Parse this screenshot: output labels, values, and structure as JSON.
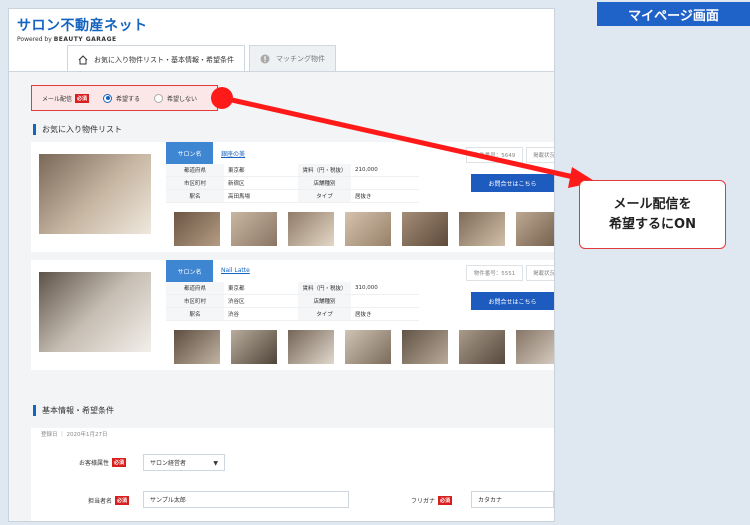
{
  "page_title": "マイページ画面",
  "logo": {
    "main": "サロン不動産ネット",
    "powered": "Powered by",
    "brand": "BEAUTY GARAGE"
  },
  "tabs": [
    {
      "label": "お気に入り物件リスト・基本情報・希望条件",
      "active": true,
      "icon": "home-icon"
    },
    {
      "label": "マッチング物件",
      "active": false,
      "icon": "alert-circle-icon"
    }
  ],
  "mail": {
    "label": "メール配信",
    "required": "必須",
    "options": [
      "希望する",
      "希望しない"
    ],
    "selected": 0
  },
  "favorites_title": "お気に入り物件リスト",
  "listings": [
    {
      "salon_label": "サロン名",
      "name": "銀座の美",
      "bukken_no": "物件番号：5649",
      "status": "掲載状況",
      "fields": [
        {
          "k": "都道府県",
          "v": "東京都",
          "k2": "賃料（円・税抜）",
          "v2": "210,000"
        },
        {
          "k": "市区町村",
          "v": "新宿区",
          "k2": "店舗種別",
          "v2": ""
        },
        {
          "k": "駅名",
          "v": "高田馬場",
          "k2": "タイプ",
          "v2": "居抜き"
        }
      ],
      "ask": "お問合せはこちら"
    },
    {
      "salon_label": "サロン名",
      "name": "Nail Latte",
      "bukken_no": "物件番号：5551",
      "status": "掲載状況",
      "fields": [
        {
          "k": "都道府県",
          "v": "東京都",
          "k2": "賃料（円・税抜）",
          "v2": "310,000"
        },
        {
          "k": "市区町村",
          "v": "渋谷区",
          "k2": "店舗種別",
          "v2": ""
        },
        {
          "k": "駅名",
          "v": "渋谷",
          "k2": "タイプ",
          "v2": "居抜き"
        }
      ],
      "ask": "お問合せはこちら"
    }
  ],
  "basic_title": "基本情報・希望条件",
  "form": {
    "registered": "登録日 ｜ 2020年1月27日",
    "attr_label": "お客様属性",
    "attr_required": "必須",
    "attr_value": "サロン経営者",
    "person_label": "担当者名",
    "person_required": "必須",
    "person_value": "サンプル太郎",
    "kana_label": "フリガナ",
    "kana_required": "必須",
    "kana_value": "カタカナ"
  },
  "callout": {
    "line1": "メール配信を",
    "line2": "希望するにON"
  },
  "colors": {
    "accent": "#1f63c8",
    "callout_red": "#e23b3b",
    "button_blue": "#1e5bbf"
  }
}
